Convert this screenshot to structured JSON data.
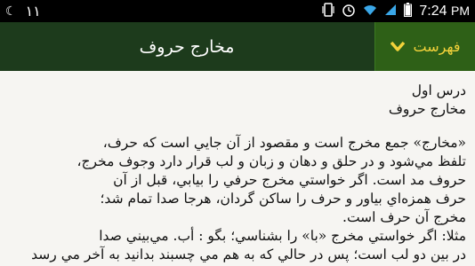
{
  "status_bar": {
    "left_number": "۱۱",
    "time": "7:24",
    "time_suffix": "PM"
  },
  "action_bar": {
    "title": "مخارج حروف",
    "index_label": "فهرست"
  },
  "content": {
    "lesson_number": "درس اول",
    "lesson_title": "مخارج حروف",
    "paragraph_lines": [
      "«مخارج» جمع مخرج است و مقصود از آن جایي است که حرف،",
      "تلفظ مي‌شود و در حلق و دهان و زبان و لب قرار دارد وجوف مخرج،",
      "حروف مد است. اگر خواستي مخرج حرفي را بيابي، قبل از آن",
      "حرف همزه‌اي بياور و حرف را ساكن گردان، هرجا صدا تمام شد؛",
      "مخرج آن حرف است.",
      "مثلا: اگر خواستي مخرج «با» را بشناسي؛ بگو : أب. مي‌بيني صدا",
      "در بين دو لب است؛ پس در حالي كه به هم مي چسبند بدانيد به آخر مي رسد"
    ]
  }
}
